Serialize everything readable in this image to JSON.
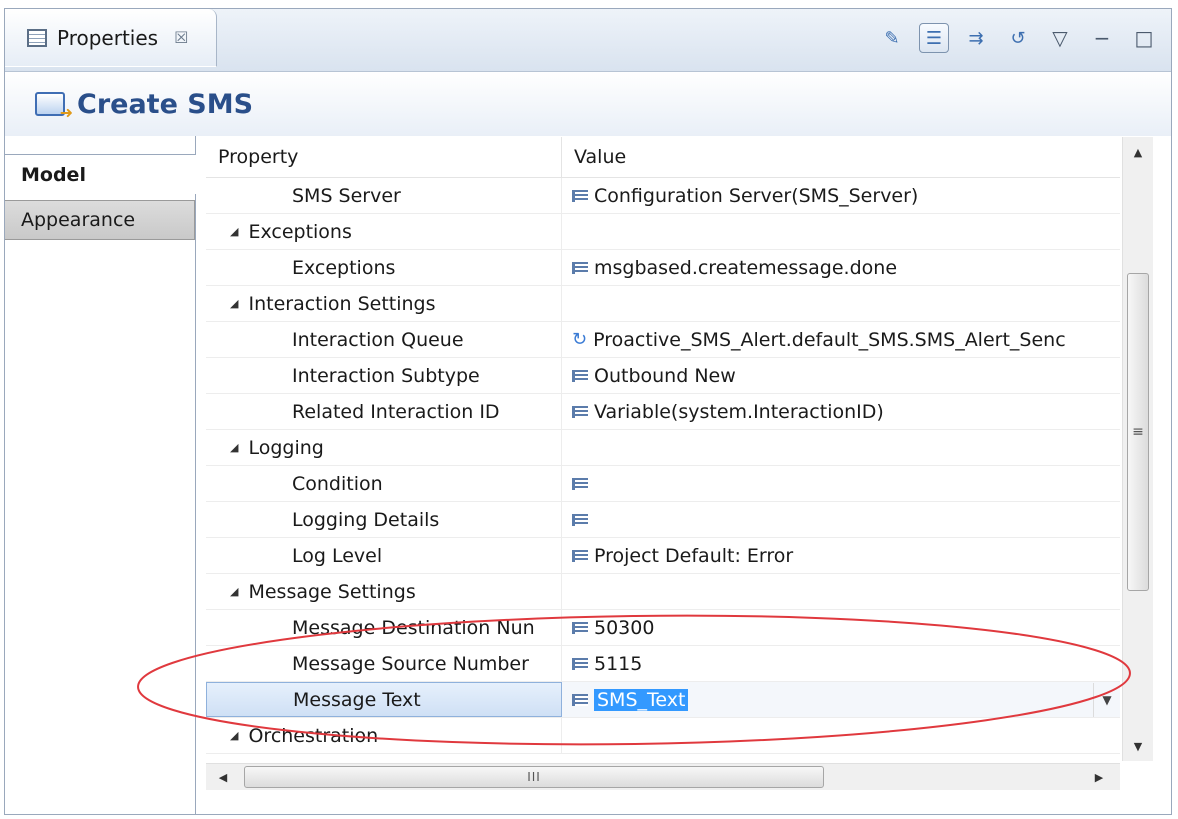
{
  "view_tab": {
    "label": "Properties",
    "close": "☒"
  },
  "header": {
    "title": "Create SMS"
  },
  "left_tabs": [
    {
      "label": "Model"
    },
    {
      "label": "Appearance"
    }
  ],
  "table": {
    "columns": {
      "property": "Property",
      "value": "Value"
    },
    "rows": [
      {
        "kind": "item",
        "property": "SMS Server",
        "value": "Configuration Server(SMS_Server)",
        "icon": "value-list-icon"
      },
      {
        "kind": "cat",
        "property": "Exceptions",
        "value": ""
      },
      {
        "kind": "item",
        "property": "Exceptions",
        "value": "msgbased.createmessage.done",
        "icon": "value-list-icon"
      },
      {
        "kind": "cat",
        "property": "Interaction Settings",
        "value": ""
      },
      {
        "kind": "item",
        "property": "Interaction Queue",
        "value": "Proactive_SMS_Alert.default_SMS.SMS_Alert_Senc",
        "icon": "queue-icon"
      },
      {
        "kind": "item",
        "property": "Interaction Subtype",
        "value": "Outbound New",
        "icon": "value-list-icon"
      },
      {
        "kind": "item",
        "property": "Related Interaction ID",
        "value": "Variable(system.InteractionID)",
        "icon": "value-list-icon"
      },
      {
        "kind": "cat",
        "property": "Logging",
        "value": ""
      },
      {
        "kind": "item",
        "property": "Condition",
        "value": "",
        "icon": "value-list-icon"
      },
      {
        "kind": "item",
        "property": "Logging Details",
        "value": "",
        "icon": "value-list-icon"
      },
      {
        "kind": "item",
        "property": "Log Level",
        "value": "Project Default: Error",
        "icon": "value-list-icon"
      },
      {
        "kind": "cat",
        "property": "Message Settings",
        "value": ""
      },
      {
        "kind": "item",
        "property": "Message Destination Nun",
        "value": "50300",
        "icon": "value-list-icon"
      },
      {
        "kind": "item",
        "property": "Message Source Number",
        "value": "5115",
        "icon": "value-list-icon"
      },
      {
        "kind": "item",
        "property": "Message Text",
        "value": "SMS_Text",
        "icon": "value-list-icon",
        "selected": true
      },
      {
        "kind": "cat",
        "property": "Orchestration",
        "value": ""
      }
    ]
  },
  "scroll": {
    "h_thumb_glyph": "III",
    "v_thumb_glyph": "≡"
  },
  "colors": {
    "annotation": "#e0393e",
    "selection": "#3399ff",
    "header_text": "#2a4f8a"
  }
}
